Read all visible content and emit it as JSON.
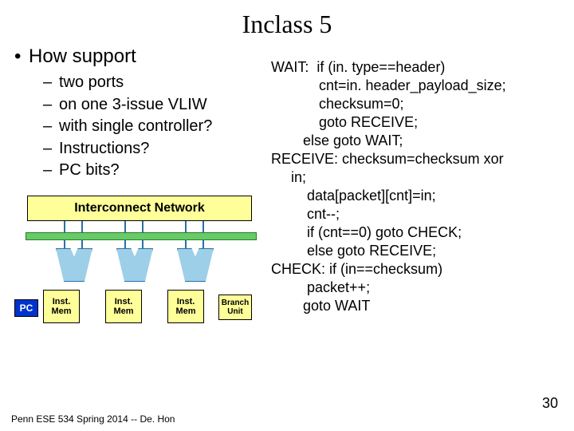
{
  "title": "Inclass 5",
  "left": {
    "heading": "How support",
    "items": [
      "two ports",
      "on one 3-issue VLIW",
      "with single controller?",
      "Instructions?",
      "PC bits?"
    ]
  },
  "diagram": {
    "interconnect": "Interconnect Network",
    "pc": "PC",
    "mem": "Inst.\nMem",
    "branch": "Branch\nUnit"
  },
  "code": {
    "l01": "WAIT:  if (in. type==header)",
    "l02": "            cnt=in. header_payload_size;",
    "l03": "            checksum=0;",
    "l04": "            goto RECEIVE;",
    "l05": "        else goto WAIT;",
    "l06": "RECEIVE: checksum=checksum xor",
    "l07": "     in;",
    "l08": "         data[packet][cnt]=in;",
    "l09": "         cnt--;",
    "l10": "         if (cnt==0) goto CHECK;",
    "l11": "         else goto RECEIVE;",
    "l12": "CHECK: if (in==checksum)",
    "l13": "         packet++;",
    "l14": "        goto WAIT"
  },
  "footer": "Penn ESE 534 Spring 2014 -- De. Hon",
  "page": "30"
}
